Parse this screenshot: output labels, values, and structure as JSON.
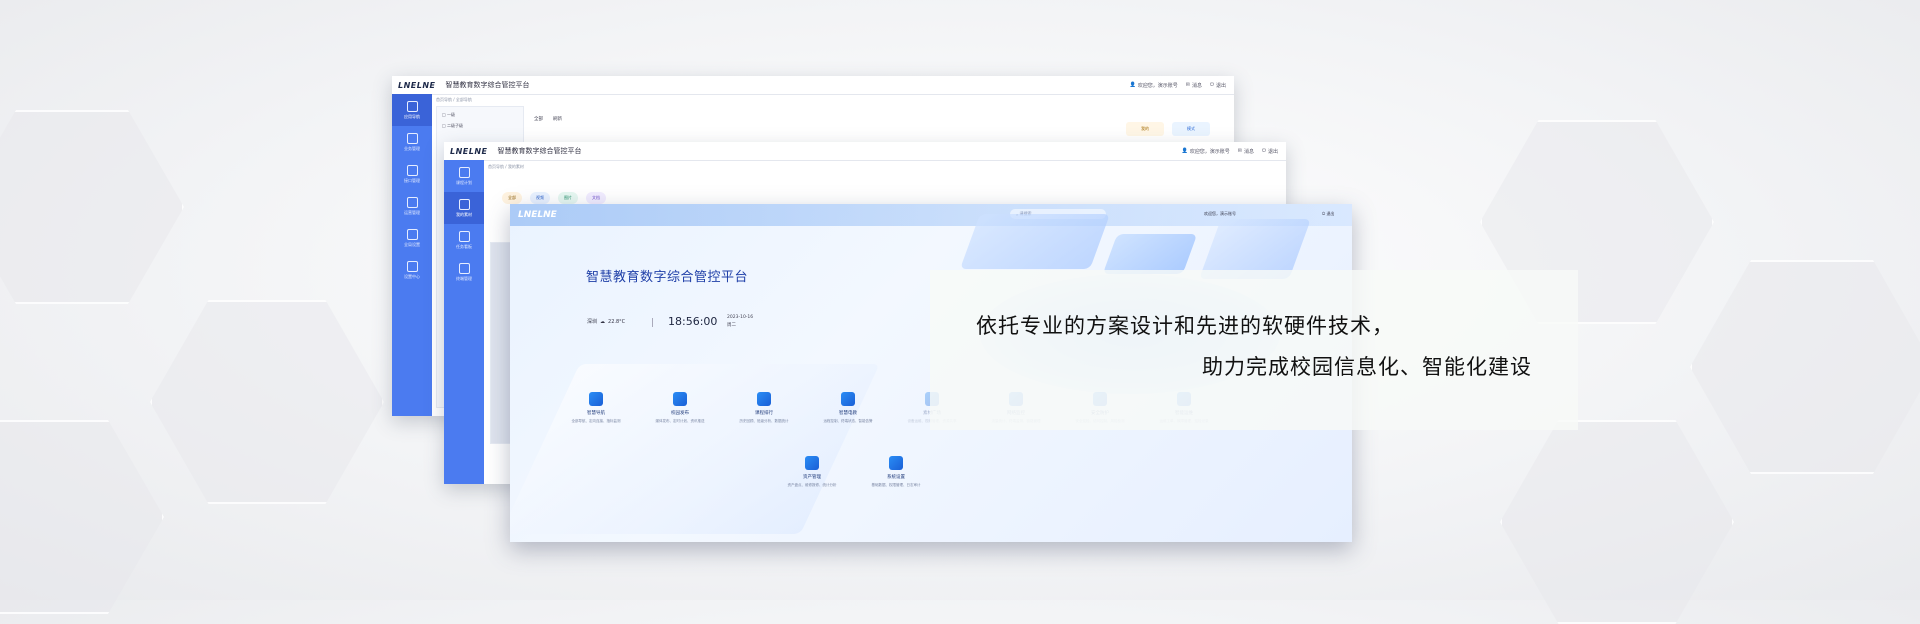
{
  "brand": {
    "logo_text": "LNELNE"
  },
  "back_window": {
    "title": "智慧教育数字综合管控平台",
    "user_label": "欢迎您，演示账号",
    "msg_label": "消息",
    "exit_label": "退出",
    "breadcrumb": "首页导航 / 全部导航",
    "sidebar": [
      "应用导航",
      "业务管理",
      "接口管理",
      "运营管理",
      "全局设置",
      "设置中心"
    ],
    "toolbar_items": [
      "全部",
      "刷新"
    ],
    "tree_items": [
      "□ 一级",
      "□ 二级子级"
    ],
    "cards": [
      "我的",
      "模式"
    ]
  },
  "mid_window": {
    "title": "智慧教育数字综合管控平台",
    "user_label": "欢迎您，演示账号",
    "msg_label": "消息",
    "exit_label": "退出",
    "breadcrumb": "首页导航 / 我的素材",
    "sidebar": [
      "课程计划",
      "我的素材",
      "任务看板",
      "终端管理"
    ],
    "chips": [
      "全部",
      "视频",
      "图片",
      "文档"
    ]
  },
  "dashboard": {
    "search_placeholder": "请搜索",
    "user_label": "欢迎您，演示账号",
    "exit_label": "退出",
    "title": "智慧教育数字综合管控平台",
    "city": "深圳",
    "temperature": "22.8°C",
    "time": "18:56:00",
    "date": "2023-10-16",
    "weekday": "周二",
    "modules_row1": [
      {
        "name": "智慧导航",
        "desc": "全部导航、定向连接、指标监测"
      },
      {
        "name": "校园发布",
        "desc": "媒体发布、定时计划、资讯推送"
      },
      {
        "name": "课程排行",
        "desc": "历史回顾、班级分析、数据统计"
      },
      {
        "name": "智慧电教",
        "desc": "远程控制、终端状态、智能告警"
      },
      {
        "name": "素材广场",
        "desc": "设备运维、视频管理、资源共享"
      },
      {
        "name": "网络监控",
        "desc": "流量统计、终端监测、链路管理"
      },
      {
        "name": "安全防护",
        "desc": "安全巡检、访问控制、风险检测"
      },
      {
        "name": "智能运维",
        "desc": "运维工单、故障管理、巡检记录"
      }
    ],
    "modules_row2": [
      {
        "name": "资产管理",
        "desc": "资产盘点、维修报修、统计分析"
      },
      {
        "name": "系统设置",
        "desc": "基础数据、权限管理、日志审计"
      }
    ]
  },
  "caption": {
    "line1": "依托专业的方案设计和先进的软硬件技术，",
    "line2": "助力完成校园信息化、智能化建设"
  }
}
